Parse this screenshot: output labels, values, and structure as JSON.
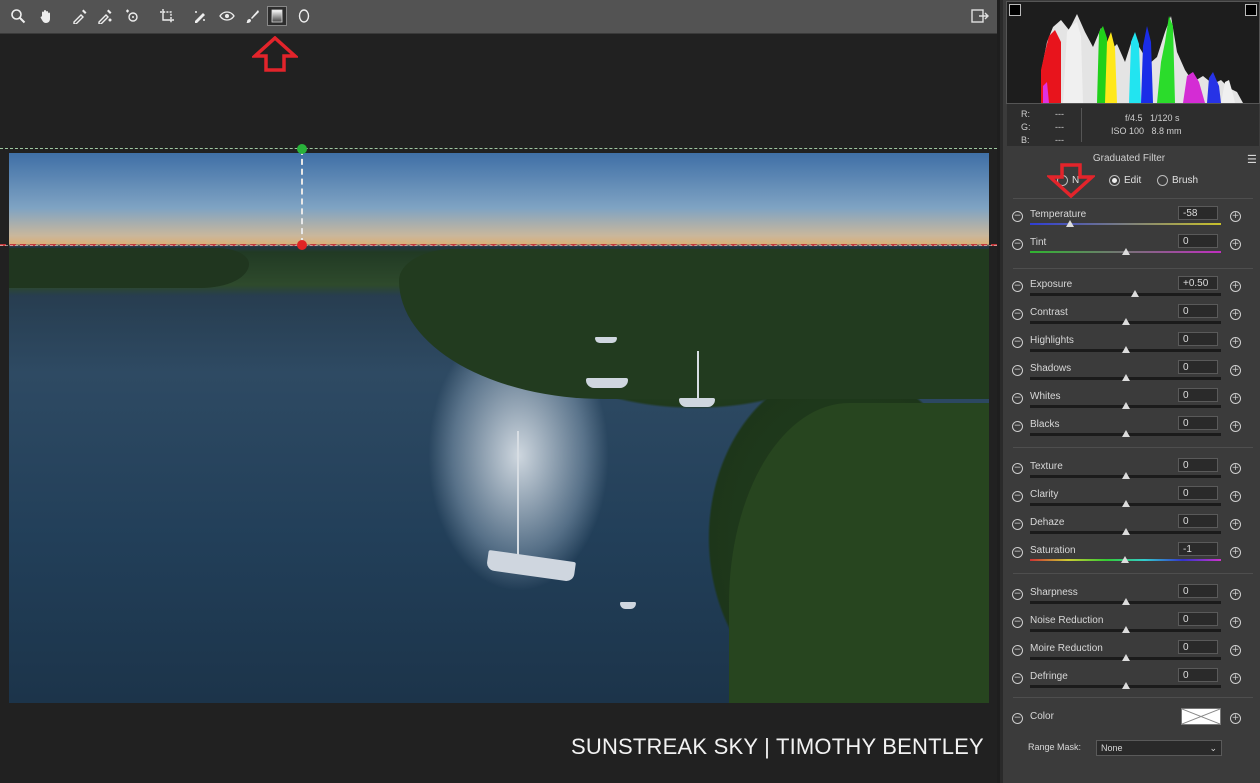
{
  "toolbar": {
    "tools": [
      "zoom-icon",
      "hand-icon",
      "white-balance-icon",
      "color-sampler-icon",
      "targeted-adjustment-icon",
      "straighten-icon",
      "spot-removal-icon",
      "red-eye-icon",
      "adjustment-brush-icon",
      "graduated-filter-icon",
      "radial-filter-icon"
    ],
    "active_tool": "graduated-filter-icon"
  },
  "readout": {
    "r_label": "R:",
    "g_label": "G:",
    "b_label": "B:",
    "r_value": "---",
    "g_value": "---",
    "b_value": "---",
    "aperture": "f/4.5",
    "shutter": "1/120 s",
    "iso": "ISO 100",
    "focal": "8.8 mm"
  },
  "panel": {
    "title": "Graduated Filter",
    "mode_new": "N",
    "mode_edit": "Edit",
    "mode_brush": "Brush",
    "selected_mode": "Edit"
  },
  "sliders": [
    {
      "label": "Temperature",
      "value": "-58",
      "level": -0.58
    },
    {
      "label": "Tint",
      "value": "0",
      "level": 0
    },
    {
      "label": "Exposure",
      "value": "+0.50",
      "level": 0.1
    },
    {
      "label": "Contrast",
      "value": "0",
      "level": 0
    },
    {
      "label": "Highlights",
      "value": "0",
      "level": 0
    },
    {
      "label": "Shadows",
      "value": "0",
      "level": 0
    },
    {
      "label": "Whites",
      "value": "0",
      "level": 0
    },
    {
      "label": "Blacks",
      "value": "0",
      "level": 0
    },
    {
      "label": "Texture",
      "value": "0",
      "level": 0
    },
    {
      "label": "Clarity",
      "value": "0",
      "level": 0
    },
    {
      "label": "Dehaze",
      "value": "0",
      "level": 0
    },
    {
      "label": "Saturation",
      "value": "-1",
      "level": -0.01
    },
    {
      "label": "Sharpness",
      "value": "0",
      "level": 0
    },
    {
      "label": "Noise Reduction",
      "value": "0",
      "level": 0
    },
    {
      "label": "Moire Reduction",
      "value": "0",
      "level": 0
    },
    {
      "label": "Defringe",
      "value": "0",
      "level": 0
    }
  ],
  "color": {
    "label": "Color"
  },
  "range_mask": {
    "label": "Range Mask:",
    "value": "None"
  },
  "watermark": "SUNSTREAK SKY | TIMOTHY BENTLEY"
}
